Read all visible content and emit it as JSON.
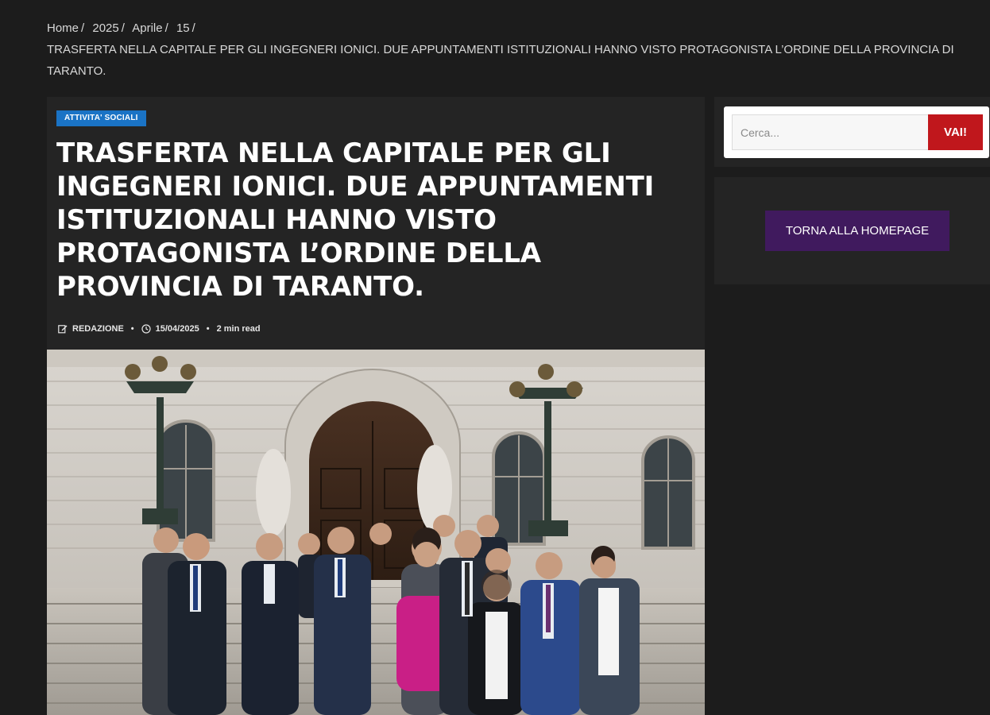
{
  "breadcrumb": {
    "items": [
      "Home",
      "2025",
      "Aprile",
      "15"
    ],
    "separator": "/",
    "current": "TRASFERTA NELLA CAPITALE PER GLI INGEGNERI IONICI. DUE APPUNTAMENTI ISTITUZIONALI HANNO VISTO PROTAGONISTA L’ORDINE DELLA PROVINCIA DI TARANTO."
  },
  "article": {
    "category": "ATTIVITA' SOCIALI",
    "title": "TRASFERTA NELLA CAPITALE PER GLI INGEGNERI IONICI. DUE APPUNTAMENTI ISTITUZIONALI HANNO VISTO PROTAGONISTA L’ORDINE DELLA PROVINCIA DI TARANTO.",
    "meta": {
      "author": "Redazione",
      "date": "15/04/2025",
      "read_time": "2 min read",
      "separator": "•"
    }
  },
  "sidebar": {
    "search": {
      "placeholder": "Cerca...",
      "button_label": "VAI!"
    },
    "home_button_label": "TORNA ALLA HOMEPAGE"
  },
  "colors": {
    "page_background": "#1c1c1c",
    "panel_background": "#242424",
    "category_badge": "#1a73c5",
    "search_button": "#c0171c",
    "home_button": "#401a5e"
  },
  "icons": {
    "author": "edit-icon",
    "date": "clock-icon"
  }
}
